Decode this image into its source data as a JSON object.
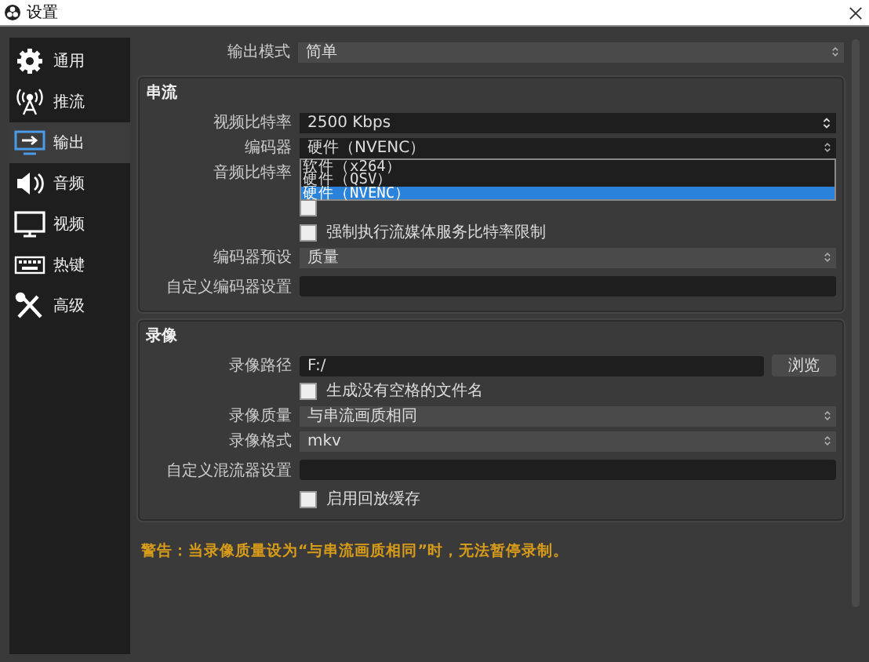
{
  "window": {
    "title": "设置"
  },
  "sidebar": {
    "items": [
      {
        "label": "通用",
        "kind": "gear",
        "selected": false
      },
      {
        "label": "推流",
        "kind": "antenna",
        "selected": false
      },
      {
        "label": "输出",
        "kind": "output",
        "selected": true
      },
      {
        "label": "音频",
        "kind": "speaker",
        "selected": false
      },
      {
        "label": "视频",
        "kind": "monitor",
        "selected": false
      },
      {
        "label": "热键",
        "kind": "keyboard",
        "selected": false
      },
      {
        "label": "高级",
        "kind": "tools",
        "selected": false
      }
    ]
  },
  "output_mode": {
    "label": "输出模式",
    "value": "简单"
  },
  "streaming": {
    "title": "串流",
    "rows": [
      {
        "kind": "spin",
        "label": "视频比特率",
        "value": "2500 Kbps"
      },
      {
        "kind": "combo",
        "label": "编码器",
        "value": "硬件（NVENC）",
        "open": true
      },
      {
        "kind": "label",
        "label": "音频比特率"
      },
      {
        "kind": "checkbox",
        "checked": false
      },
      {
        "kind": "checkbox",
        "label": "强制执行流媒体服务比特率限制",
        "checked": false
      },
      {
        "kind": "combo",
        "label": "编码器预设",
        "value": "质量"
      },
      {
        "kind": "input",
        "label": "自定义编码器设置"
      }
    ]
  },
  "encoder_dropdown": {
    "options": [
      {
        "label": "软件（x264）",
        "selected": false
      },
      {
        "label": "硬件（QSV）",
        "selected": false
      },
      {
        "label": "硬件（NVENC）",
        "selected": true
      }
    ]
  },
  "recording": {
    "title": "录像",
    "rows": [
      {
        "kind": "path",
        "label": "录像路径",
        "value": "F:/",
        "button": "浏览"
      },
      {
        "kind": "checkbox",
        "label": "生成没有空格的文件名",
        "checked": false
      },
      {
        "kind": "combo",
        "label": "录像质量",
        "value": "与串流画质相同"
      },
      {
        "kind": "combo",
        "label": "录像格式",
        "value": "mkv"
      },
      {
        "kind": "input",
        "label": "自定义混流器设置"
      },
      {
        "kind": "checkbox",
        "label": "启用回放缓存",
        "checked": false
      }
    ]
  },
  "warning": "警告：当录像质量设为“与串流画质相同”时，无法暂停录制。"
}
